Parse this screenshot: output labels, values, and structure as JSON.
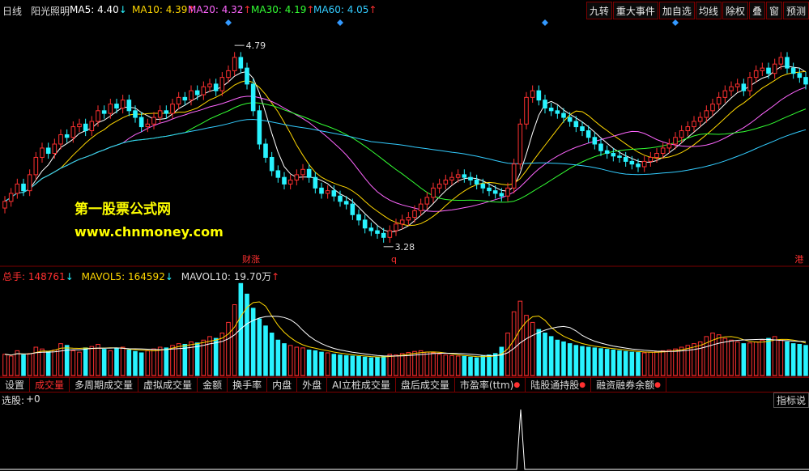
{
  "header": {
    "period": "日线",
    "indicator": "阳光照明",
    "ma5": {
      "label": "MA5:",
      "value": "4.40",
      "dir": "↓",
      "color": "#ffffff"
    },
    "ma10": {
      "label": "MA10:",
      "value": "4.39",
      "dir": "↑",
      "color": "#ffd700"
    },
    "ma20": {
      "label": "MA20:",
      "value": "4.32",
      "dir": "↑",
      "color": "#ff66ff"
    },
    "ma30": {
      "label": "MA30:",
      "value": "4.19",
      "dir": "↑",
      "color": "#33ff33"
    },
    "ma60": {
      "label": "MA60:",
      "value": "4.05",
      "dir": "↑",
      "color": "#33ccff"
    }
  },
  "right_buttons": [
    "九转",
    "重大事件",
    "加自选",
    "均线",
    "除权",
    "叠",
    "窗",
    "预测"
  ],
  "watermark": {
    "cn": "第一股票公式网",
    "url": "www.chnmoney.com"
  },
  "volume_header": {
    "total": {
      "label": "总手:",
      "value": "148761",
      "dir": "↓"
    },
    "mavol5": {
      "label": "MAVOL5:",
      "value": "164592",
      "dir": "↓"
    },
    "mavol10": {
      "label": "MAVOL10:",
      "value": "19.70万",
      "dir": "↑"
    }
  },
  "tabs": [
    {
      "label": "设置",
      "active": false,
      "dot": false
    },
    {
      "label": "成交量",
      "active": true,
      "dot": false
    },
    {
      "label": "多周期成交量",
      "active": false,
      "dot": false
    },
    {
      "label": "虚拟成交量",
      "active": false,
      "dot": false
    },
    {
      "label": "金额",
      "active": false,
      "dot": false
    },
    {
      "label": "换手率",
      "active": false,
      "dot": false
    },
    {
      "label": "内盘",
      "active": false,
      "dot": false
    },
    {
      "label": "外盘",
      "active": false,
      "dot": false
    },
    {
      "label": "AI立桩成交量",
      "active": false,
      "dot": false
    },
    {
      "label": "盘后成交量",
      "active": false,
      "dot": false
    },
    {
      "label": "市盈率(ttm)",
      "active": false,
      "dot": true
    },
    {
      "label": "陆股通持股",
      "active": false,
      "dot": true
    },
    {
      "label": "融资融券余额",
      "active": false,
      "dot": true
    }
  ],
  "xuangu": {
    "label": "选股:",
    "value": "+0"
  },
  "index_button": "指标说",
  "chart_data": {
    "type": "candlestick",
    "price_ylim": [
      3.2,
      4.9
    ],
    "high_label": "4.79",
    "low_label": "3.28",
    "event_markers": [
      {
        "label": "财涨",
        "index": 39
      },
      {
        "label": "q",
        "index": 63
      },
      {
        "label": "港",
        "index": 128
      }
    ],
    "close": [
      3.62,
      3.68,
      3.75,
      3.7,
      3.82,
      3.95,
      4.02,
      3.98,
      4.05,
      4.12,
      4.1,
      4.18,
      4.2,
      4.15,
      4.22,
      4.3,
      4.28,
      4.35,
      4.32,
      4.38,
      4.3,
      4.25,
      4.18,
      4.2,
      4.25,
      4.3,
      4.28,
      4.35,
      4.4,
      4.38,
      4.45,
      4.42,
      4.48,
      4.5,
      4.45,
      4.55,
      4.6,
      4.7,
      4.62,
      4.5,
      4.3,
      4.05,
      3.95,
      3.85,
      3.8,
      3.75,
      3.78,
      3.82,
      3.86,
      3.8,
      3.72,
      3.68,
      3.7,
      3.66,
      3.62,
      3.6,
      3.52,
      3.48,
      3.42,
      3.4,
      3.38,
      3.35,
      3.4,
      3.45,
      3.48,
      3.5,
      3.55,
      3.6,
      3.65,
      3.72,
      3.75,
      3.78,
      3.8,
      3.82,
      3.8,
      3.78,
      3.75,
      3.72,
      3.7,
      3.68,
      3.66,
      3.72,
      3.9,
      4.2,
      4.4,
      4.45,
      4.38,
      4.32,
      4.3,
      4.28,
      4.25,
      4.22,
      4.18,
      4.15,
      4.1,
      4.05,
      4.0,
      3.98,
      3.96,
      3.95,
      3.92,
      3.9,
      3.88,
      3.92,
      3.95,
      3.98,
      4.02,
      4.05,
      4.1,
      4.15,
      4.18,
      4.22,
      4.25,
      4.3,
      4.35,
      4.4,
      4.45,
      4.48,
      4.5,
      4.45,
      4.55,
      4.6,
      4.62,
      4.58,
      4.65,
      4.7,
      4.62,
      4.58,
      4.55,
      4.5
    ],
    "volume": [
      60,
      55,
      70,
      58,
      62,
      80,
      75,
      68,
      72,
      90,
      85,
      70,
      66,
      78,
      82,
      88,
      74,
      70,
      76,
      80,
      72,
      68,
      64,
      70,
      75,
      80,
      78,
      85,
      90,
      88,
      95,
      92,
      100,
      110,
      105,
      120,
      150,
      200,
      260,
      230,
      190,
      160,
      140,
      120,
      100,
      90,
      85,
      80,
      78,
      72,
      70,
      66,
      64,
      60,
      58,
      56,
      55,
      54,
      52,
      50,
      52,
      55,
      60,
      58,
      62,
      65,
      68,
      70,
      66,
      64,
      60,
      58,
      56,
      55,
      54,
      52,
      50,
      55,
      58,
      62,
      80,
      120,
      180,
      210,
      170,
      150,
      130,
      120,
      110,
      100,
      95,
      90,
      85,
      82,
      80,
      78,
      76,
      74,
      72,
      70,
      68,
      66,
      65,
      64,
      66,
      68,
      70,
      72,
      75,
      80,
      85,
      90,
      95,
      110,
      120,
      115,
      105,
      100,
      95,
      90,
      92,
      95,
      100,
      105,
      110,
      100,
      95,
      90,
      88,
      85
    ]
  }
}
